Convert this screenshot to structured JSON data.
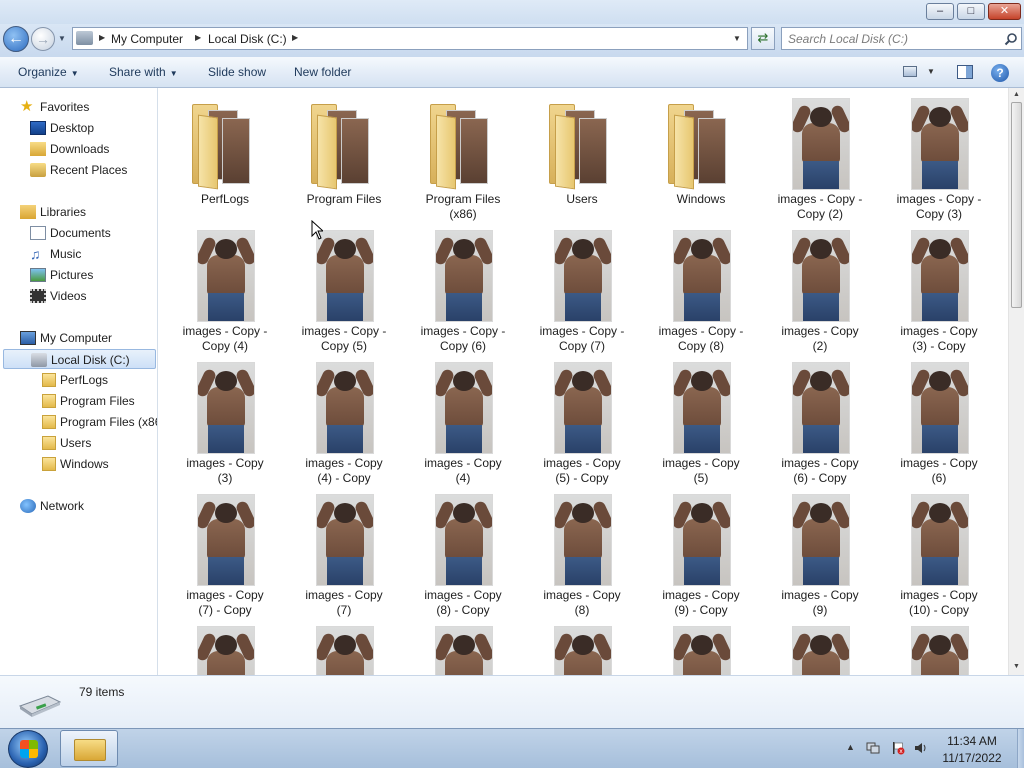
{
  "window": {
    "minimize_icon": "minimize-icon",
    "maximize_icon": "maximize-icon",
    "close_icon": "close-icon"
  },
  "navigation": {
    "back_icon": "arrow-left-icon",
    "forward_icon": "arrow-right-icon",
    "breadcrumbs": [
      "My Computer",
      "Local Disk (C:)"
    ],
    "search_placeholder": "Search Local Disk (C:)"
  },
  "toolbar": {
    "organize": "Organize",
    "share_with": "Share with",
    "slide_show": "Slide show",
    "new_folder": "New folder"
  },
  "sidebar": {
    "favorites": "Favorites",
    "desktop": "Desktop",
    "downloads": "Downloads",
    "recent_places": "Recent Places",
    "libraries": "Libraries",
    "documents": "Documents",
    "music": "Music",
    "pictures": "Pictures",
    "videos": "Videos",
    "my_computer": "My Computer",
    "local_disk": "Local Disk (C:)",
    "perflogs": "PerfLogs",
    "program_files": "Program Files",
    "program_files_x86": "Program Files (x86",
    "users": "Users",
    "windows": "Windows",
    "network": "Network"
  },
  "files": [
    {
      "l1": "PerfLogs",
      "l2": "",
      "kind": "folder"
    },
    {
      "l1": "Program Files",
      "l2": "",
      "kind": "folder"
    },
    {
      "l1": "Program Files",
      "l2": "(x86)",
      "kind": "folder"
    },
    {
      "l1": "Users",
      "l2": "",
      "kind": "folder"
    },
    {
      "l1": "Windows",
      "l2": "",
      "kind": "folder"
    },
    {
      "l1": "images - Copy -",
      "l2": "Copy (2)",
      "kind": "image"
    },
    {
      "l1": "images - Copy -",
      "l2": "Copy (3)",
      "kind": "image"
    },
    {
      "l1": "images - Copy -",
      "l2": "Copy (4)",
      "kind": "image"
    },
    {
      "l1": "images - Copy -",
      "l2": "Copy (5)",
      "kind": "image"
    },
    {
      "l1": "images - Copy -",
      "l2": "Copy (6)",
      "kind": "image"
    },
    {
      "l1": "images - Copy -",
      "l2": "Copy (7)",
      "kind": "image"
    },
    {
      "l1": "images - Copy -",
      "l2": "Copy (8)",
      "kind": "image"
    },
    {
      "l1": "images - Copy",
      "l2": "(2)",
      "kind": "image"
    },
    {
      "l1": "images - Copy",
      "l2": "(3) - Copy",
      "kind": "image"
    },
    {
      "l1": "images - Copy",
      "l2": "(3)",
      "kind": "image"
    },
    {
      "l1": "images - Copy",
      "l2": "(4) - Copy",
      "kind": "image"
    },
    {
      "l1": "images - Copy",
      "l2": "(4)",
      "kind": "image"
    },
    {
      "l1": "images - Copy",
      "l2": "(5) - Copy",
      "kind": "image"
    },
    {
      "l1": "images - Copy",
      "l2": "(5)",
      "kind": "image"
    },
    {
      "l1": "images - Copy",
      "l2": "(6) - Copy",
      "kind": "image"
    },
    {
      "l1": "images - Copy",
      "l2": "(6)",
      "kind": "image"
    },
    {
      "l1": "images - Copy",
      "l2": "(7) - Copy",
      "kind": "image"
    },
    {
      "l1": "images - Copy",
      "l2": "(7)",
      "kind": "image"
    },
    {
      "l1": "images - Copy",
      "l2": "(8) - Copy",
      "kind": "image"
    },
    {
      "l1": "images - Copy",
      "l2": "(8)",
      "kind": "image"
    },
    {
      "l1": "images - Copy",
      "l2": "(9) - Copy",
      "kind": "image"
    },
    {
      "l1": "images - Copy",
      "l2": "(9)",
      "kind": "image"
    },
    {
      "l1": "images - Copy",
      "l2": "(10) - Copy",
      "kind": "image"
    },
    {
      "l1": "",
      "l2": "",
      "kind": "image"
    },
    {
      "l1": "",
      "l2": "",
      "kind": "image"
    },
    {
      "l1": "",
      "l2": "",
      "kind": "image"
    },
    {
      "l1": "",
      "l2": "",
      "kind": "image"
    },
    {
      "l1": "",
      "l2": "",
      "kind": "image"
    },
    {
      "l1": "",
      "l2": "",
      "kind": "image"
    },
    {
      "l1": "",
      "l2": "",
      "kind": "image"
    }
  ],
  "status": {
    "item_count": "79 items"
  },
  "taskbar": {
    "time": "11:34 AM",
    "date": "11/17/2022"
  },
  "colors": {
    "accent": "#2d6bc0",
    "selection": "#cde0f7"
  }
}
